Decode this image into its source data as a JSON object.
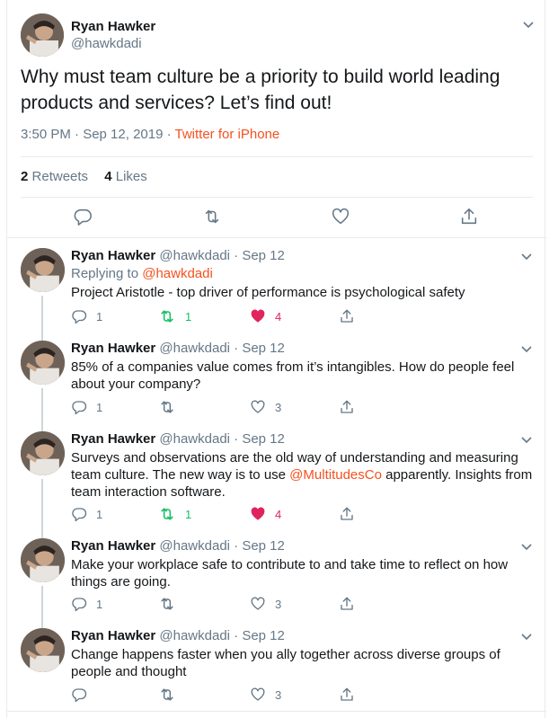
{
  "main_tweet": {
    "author_name": "Ryan Hawker",
    "author_handle": "@hawkdadi",
    "text": "Why must team culture be a priority to build world leading products and services? Let’s find out!",
    "time": "3:50 PM · Sep 12, 2019 · ",
    "source": "Twitter for iPhone",
    "retweets_count": "2",
    "retweets_label": "Retweets",
    "likes_count": "4",
    "likes_label": "Likes"
  },
  "replies": [
    {
      "name": "Ryan Hawker",
      "handle_date": "@hawkdadi · Sep 12",
      "replying_prefix": "Replying to ",
      "replying_to": "@hawkdadi",
      "text": "Project Aristotle - top driver of performance is psychological safety",
      "reply_count": "1",
      "retweet_count": "1",
      "like_count": "4",
      "retweeted": true,
      "liked": true
    },
    {
      "name": "Ryan Hawker",
      "handle_date": "@hawkdadi · Sep 12",
      "text": "85% of a companies value comes from it’s intangibles. How do people feel about your company?",
      "reply_count": "1",
      "retweet_count": "",
      "like_count": "3",
      "retweeted": false,
      "liked": false
    },
    {
      "name": "Ryan Hawker",
      "handle_date": "@hawkdadi · Sep 12",
      "text_before": "Surveys and observations are the old way of understanding and measuring team culture. The new way is to use ",
      "mention": "@MultitudesCo",
      "text_after": " apparently. Insights from team interaction software.",
      "reply_count": "1",
      "retweet_count": "1",
      "like_count": "4",
      "retweeted": true,
      "liked": true
    },
    {
      "name": "Ryan Hawker",
      "handle_date": "@hawkdadi · Sep 12",
      "text": "Make your workplace safe to contribute to and take time to reflect on how things are going.",
      "reply_count": "1",
      "retweet_count": "",
      "like_count": "3",
      "retweeted": false,
      "liked": false
    },
    {
      "name": "Ryan Hawker",
      "handle_date": "@hawkdadi · Sep 12",
      "text": "Change happens faster when you ally together across diverse groups of people and thought",
      "reply_count": "",
      "retweet_count": "",
      "like_count": "3",
      "retweeted": false,
      "liked": false
    }
  ],
  "colors": {
    "accent": "#f4511e",
    "muted": "#657786",
    "retweet": "#17bf63",
    "like": "#e0245e",
    "border": "#e6ecf0"
  },
  "icons": {
    "reply": "reply-icon",
    "retweet": "retweet-icon",
    "like": "heart-icon",
    "share": "share-icon",
    "more": "chevron-down-icon"
  }
}
